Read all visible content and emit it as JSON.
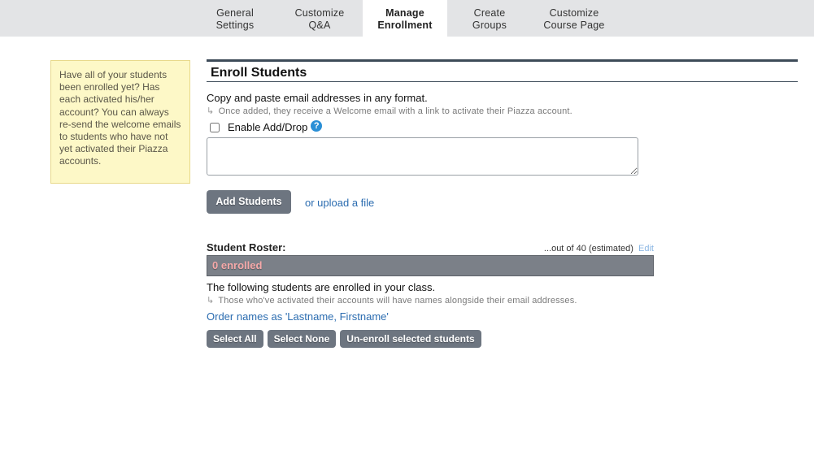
{
  "tabs": [
    {
      "line1": "General",
      "line2": "Settings",
      "active": false
    },
    {
      "line1": "Customize",
      "line2": "Q&A",
      "active": false
    },
    {
      "line1": "Manage",
      "line2": "Enrollment",
      "active": true
    },
    {
      "line1": "Create",
      "line2": "Groups",
      "active": false
    },
    {
      "line1": "Customize",
      "line2": "Course Page",
      "active": false
    }
  ],
  "tip": {
    "text": "Have all of your students been enrolled yet? Has each activated his/her account? You can always re-send the welcome emails to students who have not yet activated their Piazza accounts."
  },
  "enroll": {
    "title": "Enroll Students",
    "instruction": "Copy and paste email addresses in any format.",
    "hint": "Once added, they receive a Welcome email with a link to activate their Piazza account.",
    "hint_arrow": "↳",
    "adddrop_label": "Enable Add/Drop",
    "adddrop_checked": false,
    "help_glyph": "?",
    "emails_value": "",
    "add_button": "Add Students",
    "upload_link": "or upload a file"
  },
  "roster": {
    "title": "Student Roster:",
    "count_text": "...out of 40 (estimated)",
    "edit_link": "Edit",
    "enrolled_label": "0 enrolled",
    "following_text": "The following students are enrolled in your class.",
    "hint": "Those who've activated their accounts will have names alongside their email addresses.",
    "hint_arrow": "↳",
    "order_link": "Order names as 'Lastname, Firstname'",
    "select_all": "Select All",
    "select_none": "Select None",
    "unenroll": "Un-enroll selected students"
  },
  "colors": {
    "tabbar_bg": "#e3e4e6",
    "tip_bg": "#fdf8c7",
    "button_bg": "#6d7580",
    "enrolled_text": "#f5a9a9",
    "link": "#2b6cb0"
  }
}
